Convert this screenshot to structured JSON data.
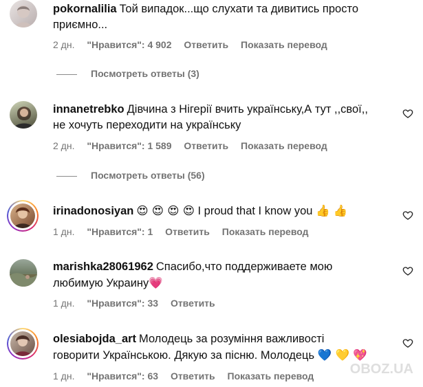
{
  "comments": [
    {
      "username": "pokornalilia",
      "text_line1": "Той випадок...що слухати та дивитись просто",
      "text_line2": "приємно...",
      "time": "2 дн.",
      "likes": "\"Нравится\": 4 902",
      "reply": "Ответить",
      "translate": "Показать перевод",
      "view_replies": "Посмотреть ответы (3)"
    },
    {
      "username": "innanetrebko",
      "text_line1": "Дівчина з Нігерії вчить українську,А тут ,,свої,,",
      "text_line2": "не хочуть переходити на українську",
      "time": "2 дн.",
      "likes": "\"Нравится\": 1 589",
      "reply": "Ответить",
      "translate": "Показать перевод",
      "view_replies": "Посмотреть ответы (56)"
    },
    {
      "username": "irinadonosiyan",
      "emoji_prefix": "😍 😍 😍 😍",
      "text_line1": "I proud that I know you",
      "emoji_suffix": "👍 👍",
      "time": "1 дн.",
      "likes": "\"Нравится\": 1",
      "reply": "Ответить",
      "translate": "Показать перевод"
    },
    {
      "username": "marishka28061962",
      "text_line1": "Спасибо,что поддерживаете мою",
      "text_line2": "любимую Украину",
      "emoji_suffix": "💗",
      "time": "1 дн.",
      "likes": "\"Нравится\": 33",
      "reply": "Ответить"
    },
    {
      "username": "olesiabojda_art",
      "text_line1": "Молодець за розуміння важливості",
      "text_line2": "говорити Українською. Дякую за пісню. Молодець",
      "emoji_suffix": "💙 💛 💖",
      "time": "1 дн.",
      "likes": "\"Нравится\": 63",
      "reply": "Ответить",
      "translate": "Показать перевод"
    }
  ],
  "watermark": "OBOZ.UA",
  "colors": {
    "meta": "#737373",
    "text": "#111111"
  },
  "icons": {
    "like": "heart-outline-icon"
  }
}
